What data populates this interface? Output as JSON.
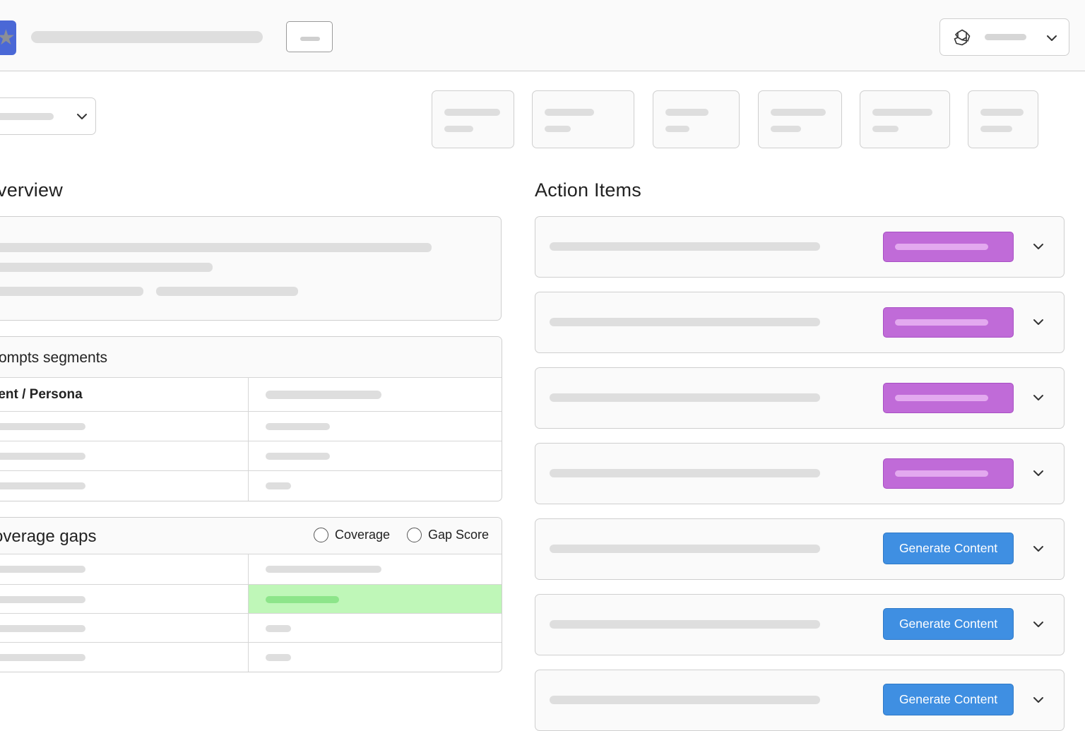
{
  "header": {
    "model_select": {
      "icon": "openai-icon"
    }
  },
  "overview": {
    "title": "verview"
  },
  "prompt_segments": {
    "title": "rompts segments",
    "header_label": "tent / Persona"
  },
  "coverage_gaps": {
    "title": "overage gaps",
    "options": [
      "Coverage",
      "Gap Score"
    ]
  },
  "action_items": {
    "title": "Action Items",
    "items": [
      {
        "kind": "tag"
      },
      {
        "kind": "tag"
      },
      {
        "kind": "tag"
      },
      {
        "kind": "tag"
      },
      {
        "kind": "button",
        "label": "Generate Content"
      },
      {
        "kind": "button",
        "label": "Generate Content"
      },
      {
        "kind": "button",
        "label": "Generate Content"
      }
    ]
  },
  "colors": {
    "accent_blue": "#3f8fe2",
    "tag_purple": "#c06bd8",
    "highlight_green": "#bff7b8",
    "logo_blue": "#4a68d6"
  }
}
